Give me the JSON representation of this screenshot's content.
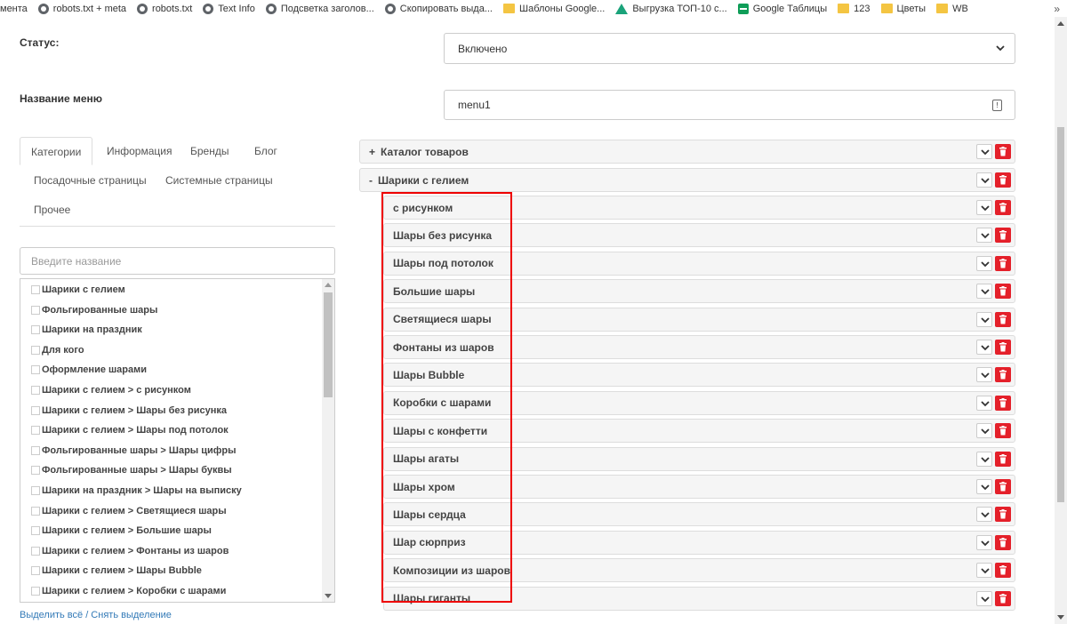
{
  "bookmarks": [
    {
      "label": "мента",
      "icon": "none"
    },
    {
      "label": "robots.txt + meta",
      "icon": "globe-icon"
    },
    {
      "label": "robots.txt",
      "icon": "globe-icon"
    },
    {
      "label": "Text Info",
      "icon": "globe-icon"
    },
    {
      "label": "Подсветка заголов...",
      "icon": "globe-icon"
    },
    {
      "label": "Скопировать выда...",
      "icon": "globe-icon"
    },
    {
      "label": "Шаблоны Google...",
      "icon": "folder-icon"
    },
    {
      "label": "Выгрузка ТОП-10 с...",
      "icon": "triangle-icon"
    },
    {
      "label": "Google Таблицы",
      "icon": "sheets-icon"
    },
    {
      "label": "123",
      "icon": "folder-icon"
    },
    {
      "label": "Цветы",
      "icon": "folder-icon"
    },
    {
      "label": "WB",
      "icon": "folder-icon"
    }
  ],
  "bookmarks_more": "»",
  "status": {
    "label": "Статус:",
    "value": "Включено"
  },
  "menu_name": {
    "label": "Название меню",
    "value": "menu1"
  },
  "tabs": [
    "Категории",
    "Информация",
    "Бренды",
    "Блог",
    "Посадочные страницы",
    "Системные страницы",
    "Прочее"
  ],
  "search": {
    "placeholder": "Введите название"
  },
  "checklist": [
    "Шарики с гелием",
    "Фольгированные шары",
    "Шарики на праздник",
    "Для кого",
    "Оформление шарами",
    "Шарики с гелием  >  с рисунком",
    "Шарики с гелием  >  Шары без рисунка",
    "Шарики с гелием  >  Шары под потолок",
    "Фольгированные шары  >  Шары цифры",
    "Фольгированные шары  >  Шары буквы",
    "Шарики на праздник  >  Шары на выписку",
    "Шарики с гелием  >  Светящиеся шары",
    "Шарики с гелием  >  Большие шары",
    "Шарики с гелием  >  Фонтаны из шаров",
    "Шарики с гелием  >  Шары Bubble",
    "Шарики с гелием  >  Коробки с шарами"
  ],
  "select_all": "Выделить всё / Снять выделение",
  "menu_tree": {
    "top": [
      {
        "prefix": "+",
        "label": "Каталог товаров"
      },
      {
        "prefix": "-",
        "label": "Шарики с гелием"
      }
    ],
    "children": [
      "с рисунком",
      "Шары без рисунка",
      "Шары под потолок",
      "Большие шары",
      "Светящиеся шары",
      "Фонтаны из шаров",
      "Шары Bubble",
      "Коробки с шарами",
      "Шары с конфетти",
      "Шары агаты",
      "Шары хром",
      "Шары сердца",
      "Шар сюрприз",
      "Композиции из шаров",
      "Шары гиганты"
    ]
  },
  "colors": {
    "delete_button": "#e4202a",
    "highlight_box": "#ee0000",
    "link": "#337ab7"
  }
}
